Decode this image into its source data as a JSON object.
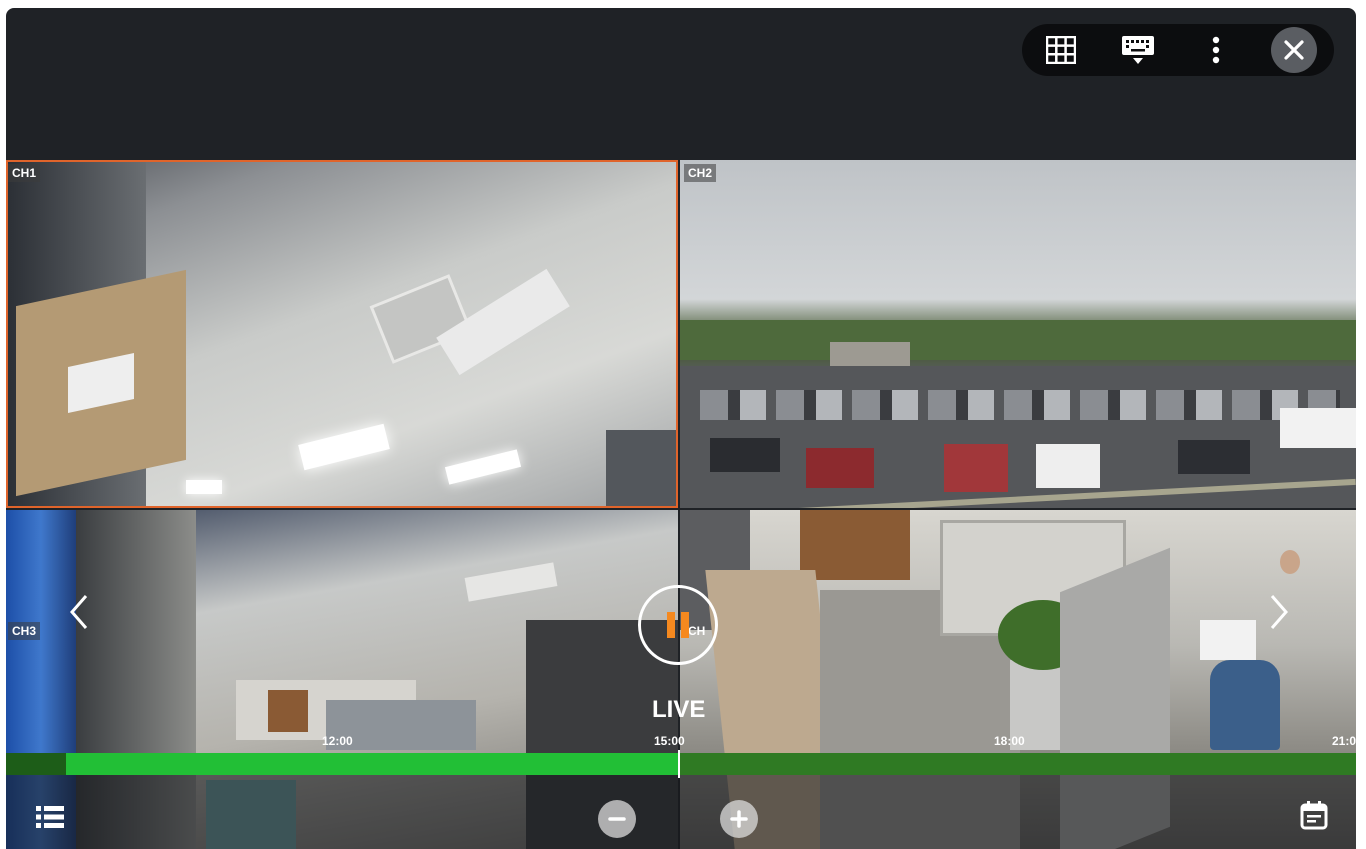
{
  "cameras": [
    {
      "id": "ch1",
      "label": "CH1",
      "selected": true
    },
    {
      "id": "ch2",
      "label": "CH2",
      "selected": false
    },
    {
      "id": "ch3",
      "label": "CH3",
      "selected": false
    },
    {
      "id": "ch4",
      "label": "CH",
      "selected": false
    }
  ],
  "toolbar": {
    "icons": [
      "grid-layout-icon",
      "keyboard-icon",
      "more-vertical-icon",
      "close-icon"
    ]
  },
  "playback": {
    "status_label": "LIVE",
    "timeline_ticks": [
      "12:00",
      "15:00",
      "18:00",
      "21:0"
    ],
    "recorded_fraction": 0.5
  },
  "bottom_controls": {
    "icons": [
      "list-icon",
      "zoom-out-icon",
      "zoom-in-icon",
      "calendar-icon"
    ]
  },
  "colors": {
    "selection_border": "#e0642b",
    "timeline_recorded": "#22bf36",
    "timeline_base": "#2f7a23",
    "pause_accent": "#f5891f"
  }
}
